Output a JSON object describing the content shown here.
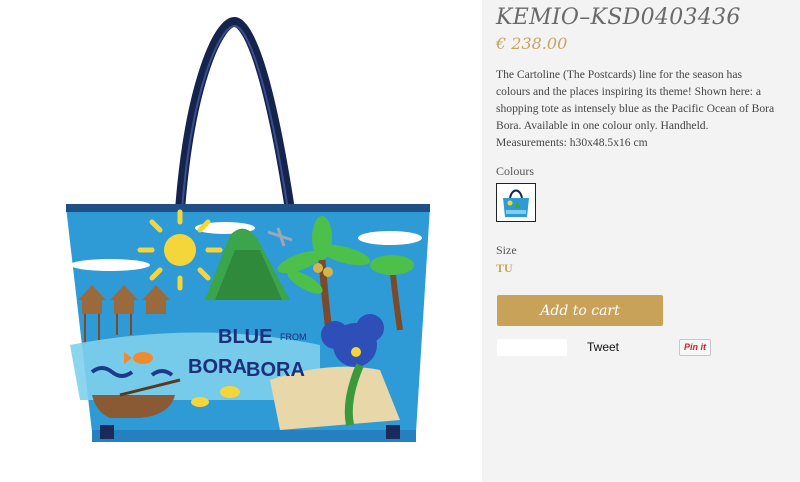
{
  "product": {
    "title": "KEMIO–KSD0403436",
    "price": "€ 238.00",
    "description": "The Cartoline (The Postcards) line for the season has colours and the places inspiring its theme! Shown here: a shopping tote as intensely blue as the Pacific Ocean of Bora Bora. Available in one colour only. Handheld. Measurements: h30x48.5x16 cm",
    "image_text": {
      "line1": "BLUE",
      "from": "FROM",
      "line2": "BORA",
      "line3": "BORA"
    }
  },
  "options": {
    "colours_label": "Colours",
    "size_label": "Size",
    "size_value": "TU"
  },
  "actions": {
    "add_to_cart_label": "Add to cart",
    "tweet_label": "Tweet",
    "pin_label": "Pin it"
  },
  "colors": {
    "accent": "#c9a25a",
    "bag_blue": "#2f9fd8",
    "handle": "#1a2a5a"
  }
}
